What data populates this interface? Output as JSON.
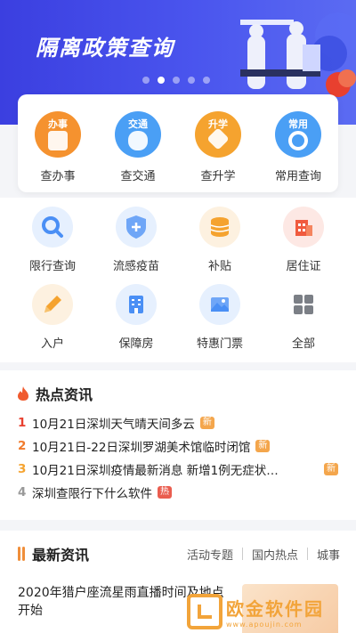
{
  "banner": {
    "title": "隔离政策查询",
    "carousel_count": 5,
    "active_index": 1
  },
  "quick_tiles": [
    {
      "tag": "办事",
      "label": "查办事",
      "color": "#f5922f",
      "icon": "document-icon"
    },
    {
      "tag": "交通",
      "label": "查交通",
      "color": "#4a9ff5",
      "icon": "bus-icon"
    },
    {
      "tag": "升学",
      "label": "查升学",
      "color": "#f5a32f",
      "icon": "book-stack-icon"
    },
    {
      "tag": "常用",
      "label": "常用查询",
      "color": "#4a9ff5",
      "icon": "search-icon"
    }
  ],
  "services": [
    {
      "label": "限行查询",
      "icon": "search-icon",
      "color": "#4a8ff5",
      "bg": "#e6f0fe"
    },
    {
      "label": "流感疫苗",
      "icon": "medical-shield-icon",
      "color": "#4a8ff5",
      "bg": "#e6f0fe"
    },
    {
      "label": "补贴",
      "icon": "coins-icon",
      "color": "#f5a32f",
      "bg": "#fdf1e0"
    },
    {
      "label": "居住证",
      "icon": "building-icon",
      "color": "#f05a3e",
      "bg": "#fde8e4"
    },
    {
      "label": "入户",
      "icon": "pencil-icon",
      "color": "#f5a32f",
      "bg": "#fdf1e0"
    },
    {
      "label": "保障房",
      "icon": "apartment-icon",
      "color": "#4a8ff5",
      "bg": "#e6f0fe"
    },
    {
      "label": "特惠门票",
      "icon": "picture-icon",
      "color": "#4a8ff5",
      "bg": "#e6f0fe"
    },
    {
      "label": "全部",
      "icon": "grid-icon",
      "color": "#7b7f86",
      "bg": "#ffffff"
    }
  ],
  "hot": {
    "title": "热点资讯",
    "items": [
      {
        "num": "1",
        "text": "10月21日深圳天气晴天间多云",
        "badge": "新",
        "badge_type": "new",
        "num_color": "#e8402f"
      },
      {
        "num": "2",
        "text": "10月21日-22日深圳罗湖美术馆临时闭馆",
        "badge": "新",
        "badge_type": "new",
        "num_color": "#f07b2d"
      },
      {
        "num": "3",
        "text": "10月21日深圳疫情最新消息 新增1例无症状…",
        "badge": "新",
        "badge_type": "new",
        "num_color": "#f5a32f"
      },
      {
        "num": "4",
        "text": "深圳查限行下什么软件",
        "badge": "热",
        "badge_type": "hot",
        "num_color": "#999999"
      }
    ]
  },
  "latest": {
    "title": "最新资讯",
    "tabs": [
      "活动专题",
      "国内热点",
      "城事"
    ],
    "article": {
      "title": "2020年猎户座流星雨直播时间及地点开始"
    }
  },
  "watermark": {
    "cn": "欧金软件园",
    "en": "www.apoujin.com"
  }
}
